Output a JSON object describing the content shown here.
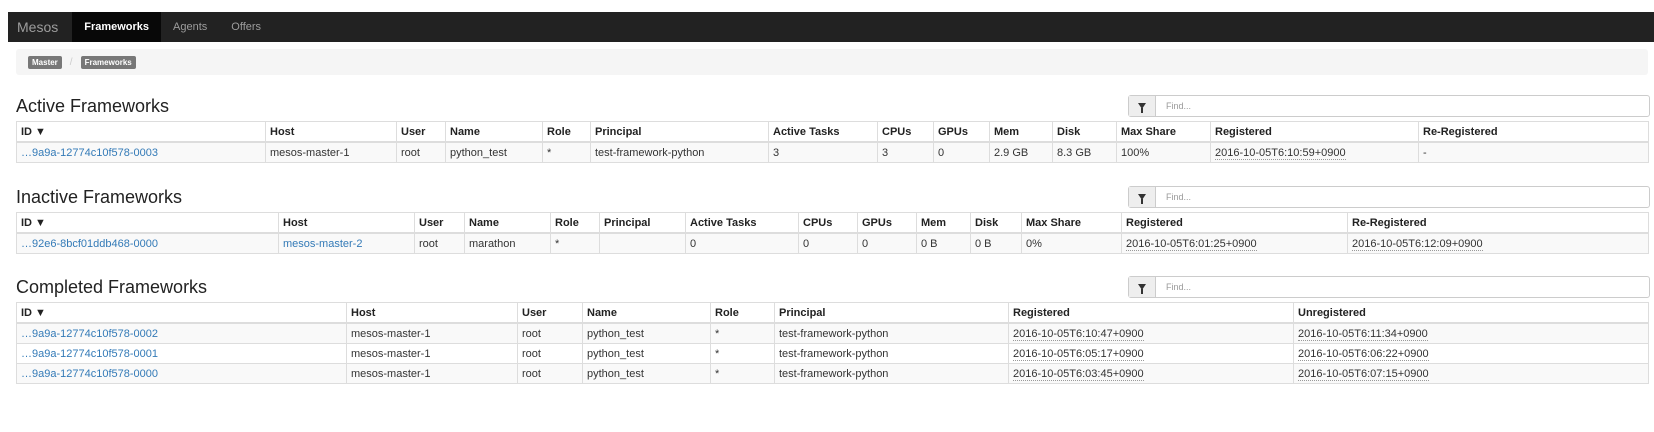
{
  "navbar": {
    "brand": "Mesos",
    "links": [
      {
        "label": "Frameworks",
        "active": true
      },
      {
        "label": "Agents",
        "active": false
      },
      {
        "label": "Offers",
        "active": false
      }
    ]
  },
  "breadcrumb": [
    "Master",
    "Frameworks"
  ],
  "breadcrumb_separator": "/",
  "filter_placeholder": "Find...",
  "sort_indicator_icon": "caret-down-icon",
  "active": {
    "title": "Active Frameworks",
    "columns": [
      "ID ▼",
      "Host",
      "User",
      "Name",
      "Role",
      "Principal",
      "Active Tasks",
      "CPUs",
      "GPUs",
      "Mem",
      "Disk",
      "Max Share",
      "Registered",
      "Re-Registered"
    ],
    "rows": [
      [
        "…9a9a-12774c10f578-0003",
        "mesos-master-1",
        "root",
        "python_test",
        "*",
        "test-framework-python",
        "3",
        "3",
        "0",
        "2.9 GB",
        "8.3 GB",
        "100%",
        "2016-10-05T6:10:59+0900",
        "-"
      ]
    ]
  },
  "inactive": {
    "title": "Inactive Frameworks",
    "columns": [
      "ID ▼",
      "Host",
      "User",
      "Name",
      "Role",
      "Principal",
      "Active Tasks",
      "CPUs",
      "GPUs",
      "Mem",
      "Disk",
      "Max Share",
      "Registered",
      "Re-Registered"
    ],
    "rows": [
      [
        "…92e6-8bcf01ddb468-0000",
        "mesos-master-2",
        "root",
        "marathon",
        "*",
        "",
        "0",
        "0",
        "0",
        "0 B",
        "0 B",
        "0%",
        "2016-10-05T6:01:25+0900",
        "2016-10-05T6:12:09+0900"
      ]
    ]
  },
  "completed": {
    "title": "Completed Frameworks",
    "columns": [
      "ID ▼",
      "Host",
      "User",
      "Name",
      "Role",
      "Principal",
      "Registered",
      "Unregistered"
    ],
    "rows": [
      [
        "…9a9a-12774c10f578-0002",
        "mesos-master-1",
        "root",
        "python_test",
        "*",
        "test-framework-python",
        "2016-10-05T6:10:47+0900",
        "2016-10-05T6:11:34+0900"
      ],
      [
        "…9a9a-12774c10f578-0001",
        "mesos-master-1",
        "root",
        "python_test",
        "*",
        "test-framework-python",
        "2016-10-05T6:05:17+0900",
        "2016-10-05T6:06:22+0900"
      ],
      [
        "…9a9a-12774c10f578-0000",
        "mesos-master-1",
        "root",
        "python_test",
        "*",
        "test-framework-python",
        "2016-10-05T6:03:45+0900",
        "2016-10-05T6:07:15+0900"
      ]
    ]
  },
  "colors": {
    "navbar": "#222222",
    "link": "#337ab7",
    "active_nav": "#080808"
  }
}
